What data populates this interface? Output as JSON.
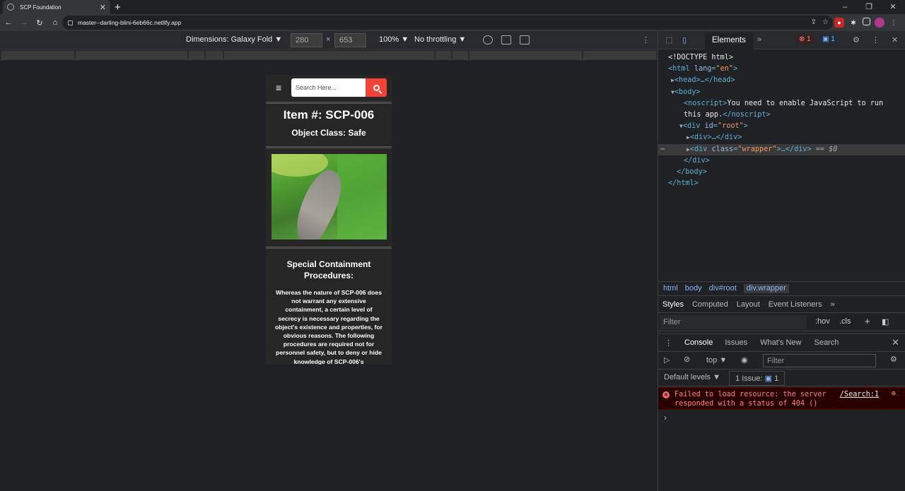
{
  "browser": {
    "tab_title": "SCP Foundation",
    "url": "master--darling-blini-6eb66c.netlify.app",
    "new_tab": "+",
    "window_controls": [
      "–",
      "❐",
      "✕"
    ]
  },
  "device_toolbar": {
    "dimensions_label": "Dimensions: Galaxy Fold ▼",
    "width": "280",
    "times": "×",
    "height": "653",
    "zoom": "100% ▼",
    "throttle": "No throttling ▼"
  },
  "site": {
    "search_placeholder": "Search Here...",
    "item_title": "Item #: SCP-006",
    "object_class": "Object Class: Safe",
    "procedures_title": "Special Containment Procedures:",
    "procedures_body": "Whereas the nature of SCP-006 does not warrant any extensive containment, a certain level of secrecy is necessary regarding the object's existence and properties, for obvious reasons. The following procedures are required not for personnel safety, but to deny or hide knowledge of SCP-006's"
  },
  "devtools": {
    "active_tab": "Elements",
    "more_tabs": "»",
    "error_count": "1",
    "message_count": "1",
    "dom": {
      "doctype": "<!DOCTYPE html>",
      "html_open": "<html",
      "lang_attr": "lang",
      "lang_val": "\"en\"",
      "head": "<head>…</head>",
      "body_open": "<body>",
      "noscript_open": "<noscript>",
      "noscript_text": "You need to enable JavaScript to run this app.",
      "noscript_close": "</noscript>",
      "root_open": "<div",
      "id_attr": "id",
      "root_val": "\"root\"",
      "div_collapsed": "<div>…</div>",
      "wrapper_open": "<div",
      "class_attr": "class",
      "wrapper_val": "\"wrapper\"",
      "wrapper_rest": ">…</div>",
      "selected_marker": "== $0",
      "div_close": "</div>",
      "body_close": "</body>",
      "html_close": "</html>"
    },
    "breadcrumbs": [
      "html",
      "body",
      "div#root",
      "div.wrapper"
    ],
    "style_tabs": [
      "Styles",
      "Computed",
      "Layout",
      "Event Listeners",
      "»"
    ],
    "filter_placeholder": "Filter",
    "hov": ":hov",
    "cls": ".cls",
    "console_tabs": [
      "Console",
      "Issues",
      "What's New",
      "Search"
    ],
    "context": "top ▼",
    "console_filter": "Filter",
    "default_levels": "Default levels ▼",
    "issues_badge": "1 Issue:",
    "issues_count": "1",
    "error_message": "Failed to load resource: the server responded with a status of 404 ()",
    "error_source": "/Search:1",
    "prompt": "›"
  }
}
